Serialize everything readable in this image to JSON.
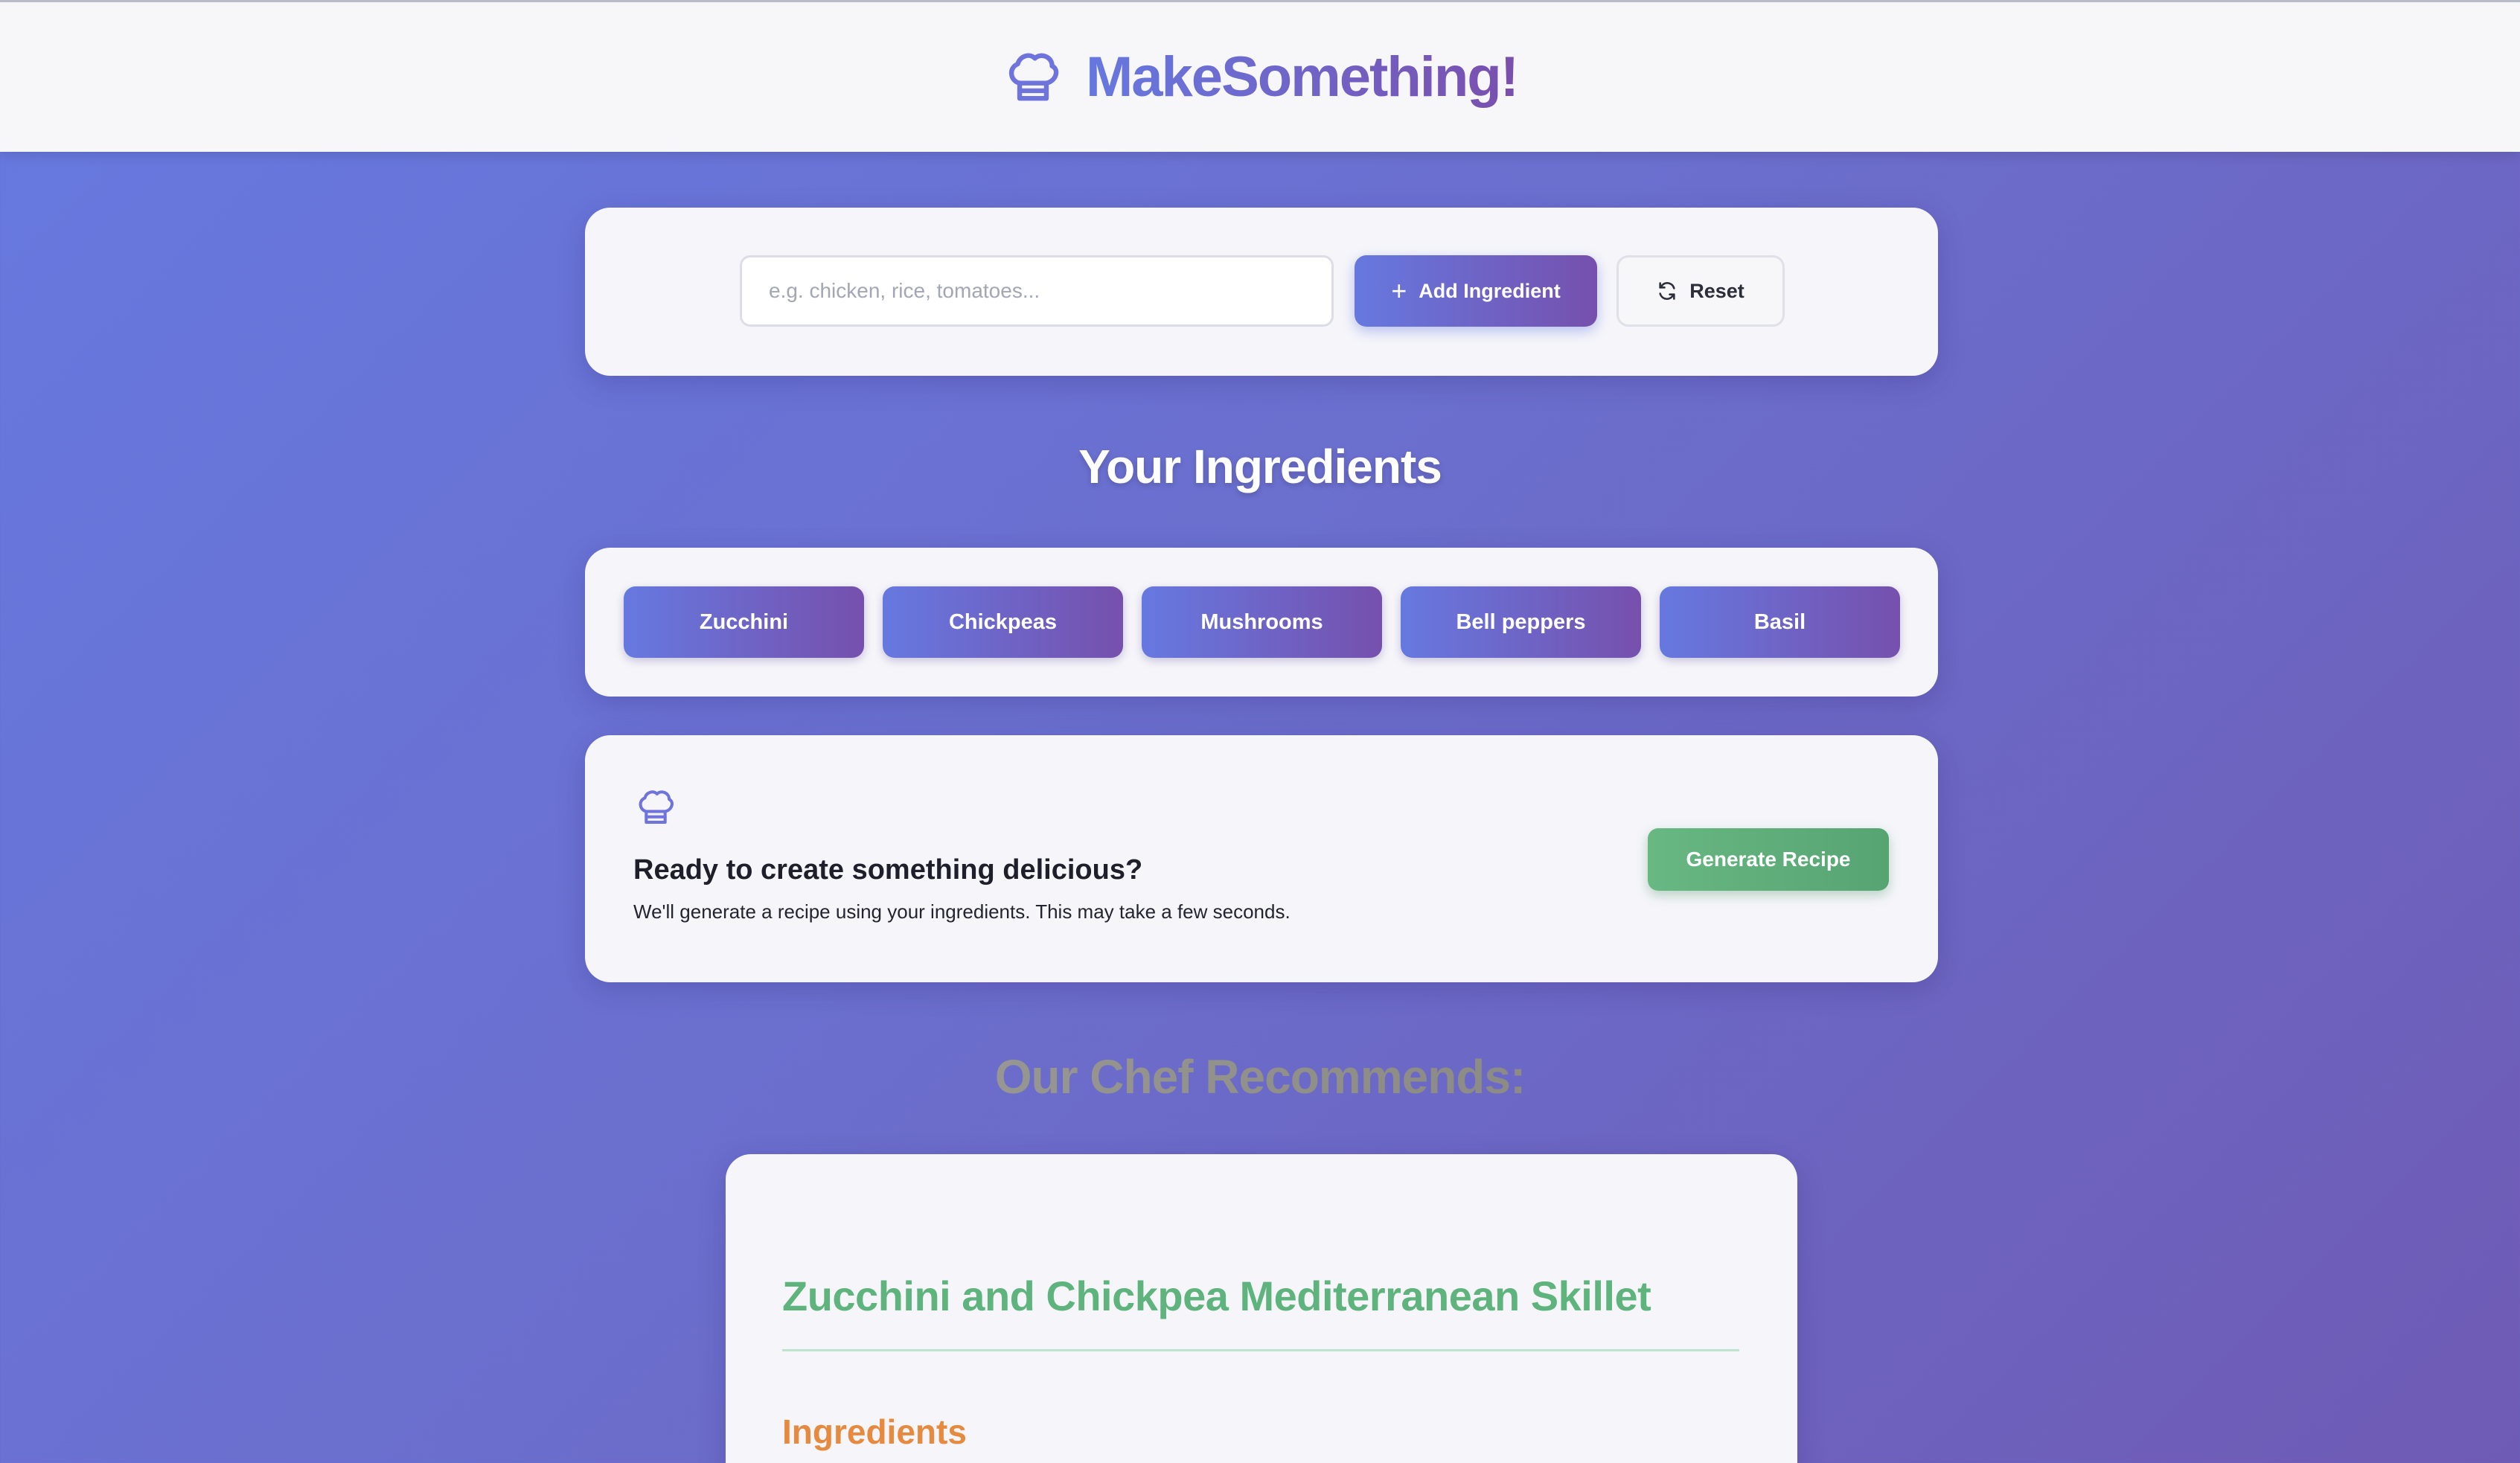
{
  "header": {
    "app_title": "MakeSomething!",
    "icon": "chef-hat-icon"
  },
  "search": {
    "placeholder": "e.g. chicken, rice, tomatoes...",
    "value": "",
    "add_label": "Add Ingredient",
    "add_icon": "plus-icon",
    "reset_label": "Reset",
    "reset_icon": "refresh-icon"
  },
  "ingredients": {
    "title": "Your Ingredients",
    "items": [
      "Zucchini",
      "Chickpeas",
      "Mushrooms",
      "Bell peppers",
      "Basil"
    ]
  },
  "generate": {
    "icon": "chef-hat-icon",
    "title": "Ready to create something delicious?",
    "description": "We'll generate a recipe using your ingredients. This may take a few seconds.",
    "button_label": "Generate Recipe"
  },
  "recommendation": {
    "title": "Our Chef Recommends:",
    "recipe_title": "Zucchini and Chickpea Mediterranean Skillet",
    "ingredients_heading": "Ingredients"
  },
  "colors": {
    "brand_start": "#6679e0",
    "brand_end": "#7650ad",
    "generate_green": "#5fa978",
    "recipe_title_green": "#5fb47d",
    "section_orange": "#e58a3f"
  }
}
